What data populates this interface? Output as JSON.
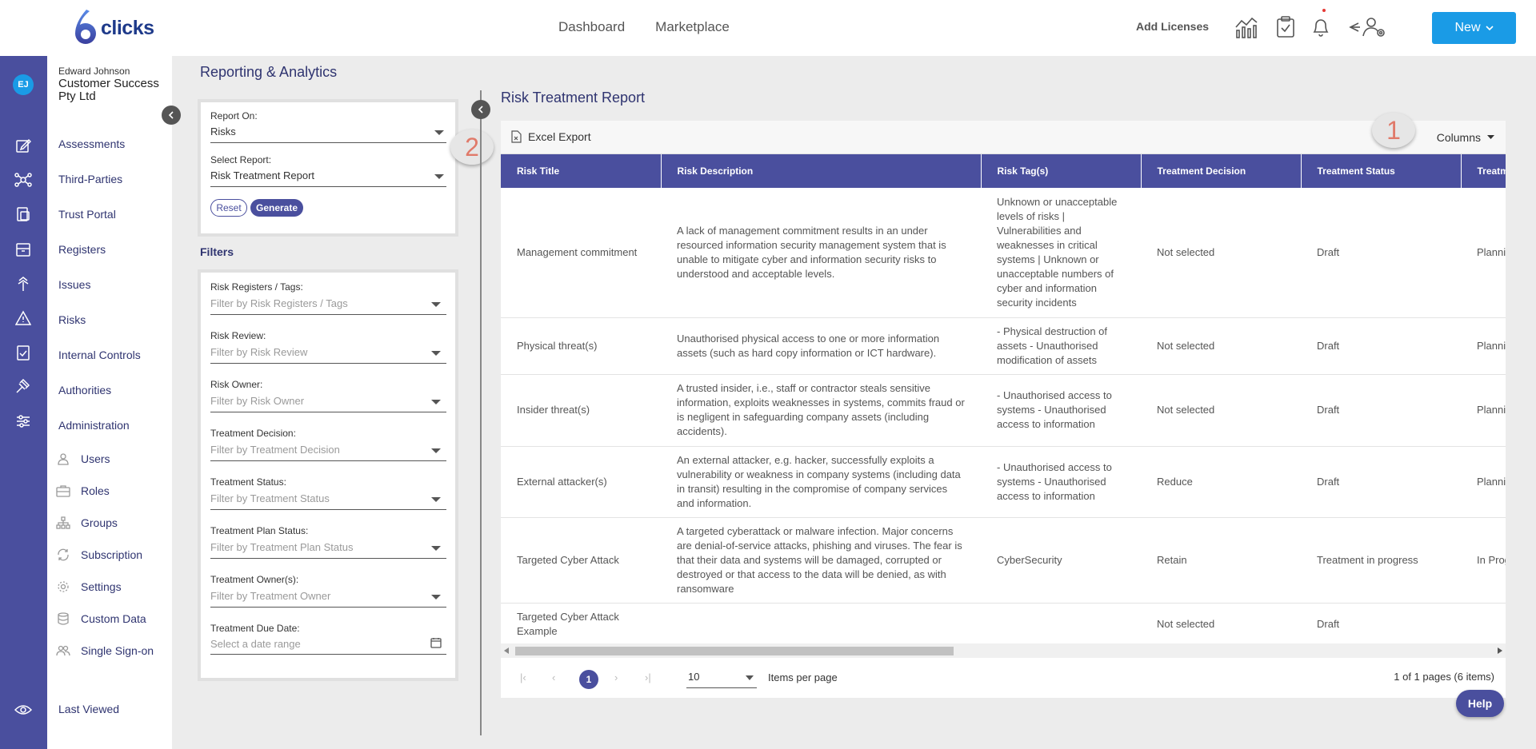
{
  "app": {
    "logo_text": "clicks",
    "logo_digit": "6"
  },
  "header": {
    "nav": [
      "Dashboard",
      "Marketplace"
    ],
    "add_licenses": "Add Licenses",
    "new_button": "New",
    "icons": [
      "analytics-icon",
      "clipboard-check-icon",
      "bell-icon",
      "user-settings-icon"
    ]
  },
  "user": {
    "initials": "EJ",
    "name": "Edward Johnson",
    "company": "Customer Success Pty Ltd"
  },
  "sidebar": {
    "items": [
      "Assessments",
      "Third-Parties",
      "Trust Portal",
      "Registers",
      "Issues",
      "Risks",
      "Internal Controls",
      "Authorities",
      "Administration"
    ],
    "admin_sub": [
      "Users",
      "Roles",
      "Groups",
      "Subscription",
      "Settings",
      "Custom Data",
      "Single Sign-on"
    ],
    "last_viewed": "Last Viewed"
  },
  "page": {
    "title": "Reporting & Analytics"
  },
  "report_selector": {
    "report_on_label": "Report On:",
    "report_on_value": "Risks",
    "select_report_label": "Select Report:",
    "select_report_value": "Risk Treatment Report",
    "reset": "Reset",
    "generate": "Generate"
  },
  "filters": {
    "title": "Filters",
    "fields": [
      {
        "label": "Risk Registers / Tags:",
        "placeholder": "Filter by Risk Registers / Tags"
      },
      {
        "label": "Risk Review:",
        "placeholder": "Filter by Risk Review"
      },
      {
        "label": "Risk Owner:",
        "placeholder": "Filter by Risk Owner"
      },
      {
        "label": "Treatment Decision:",
        "placeholder": "Filter by Treatment Decision"
      },
      {
        "label": "Treatment Status:",
        "placeholder": "Filter by Treatment Status"
      },
      {
        "label": "Treatment Plan Status:",
        "placeholder": "Filter by Treatment Plan Status"
      },
      {
        "label": "Treatment Owner(s):",
        "placeholder": "Filter by Treatment Owner"
      },
      {
        "label": "Treatment Due Date:",
        "placeholder": "Select a date range"
      }
    ]
  },
  "callouts": {
    "one": "1",
    "two": "2"
  },
  "report": {
    "title": "Risk Treatment Report",
    "excel_export": "Excel Export",
    "columns": "Columns",
    "headers": [
      "Risk Title",
      "Risk Description",
      "Risk Tag(s)",
      "Treatment Decision",
      "Treatment Status",
      "Treatm"
    ],
    "rows": [
      [
        "Management commitment",
        "A lack of management commitment results in an under resourced information security management system that is unable to mitigate cyber and information security risks to understood and acceptable levels.",
        "Unknown or unacceptable levels of risks | Vulnerabilities and weaknesses in critical systems | Unknown or unacceptable numbers of cyber and information security incidents",
        "Not selected",
        "Draft",
        "Planni"
      ],
      [
        "Physical threat(s)",
        "Unauthorised physical access to one or more information assets (such as hard copy information or ICT hardware).",
        "- Physical destruction of assets - Unauthorised modification of assets",
        "Not selected",
        "Draft",
        "Planni"
      ],
      [
        "Insider threat(s)",
        "A trusted insider, i.e., staff or contractor steals sensitive information, exploits weaknesses in systems, commits fraud or is negligent in safeguarding company assets (including accidents).",
        "- Unauthorised access to systems - Unauthorised access to information",
        "Not selected",
        "Draft",
        "Planni"
      ],
      [
        "External attacker(s)",
        "An external attacker, e.g. hacker, successfully exploits a vulnerability or weakness in company systems (including data in transit) resulting in the compromise of company services and information.",
        "- Unauthorised access to systems - Unauthorised access to information",
        "Reduce",
        "Draft",
        "Planni"
      ],
      [
        "Targeted Cyber Attack",
        "A targeted cyberattack or malware infection. Major concerns are denial-of-service attacks, phishing and viruses. The fear is that their data and systems will be damaged, corrupted or destroyed or that access to the data will be denied, as with ransomware",
        "CyberSecurity",
        "Retain",
        "Treatment in progress",
        "In Prog"
      ],
      [
        "Targeted Cyber Attack Example",
        "",
        "",
        "Not selected",
        "Draft",
        ""
      ]
    ]
  },
  "pager": {
    "current_page": "1",
    "items_per_page_value": "10",
    "items_per_page_label": "Items per page",
    "info": "1 of 1 pages (6 items)"
  },
  "help": "Help",
  "colors": {
    "primary": "#4a4f9e",
    "accent": "#1a9be6"
  }
}
